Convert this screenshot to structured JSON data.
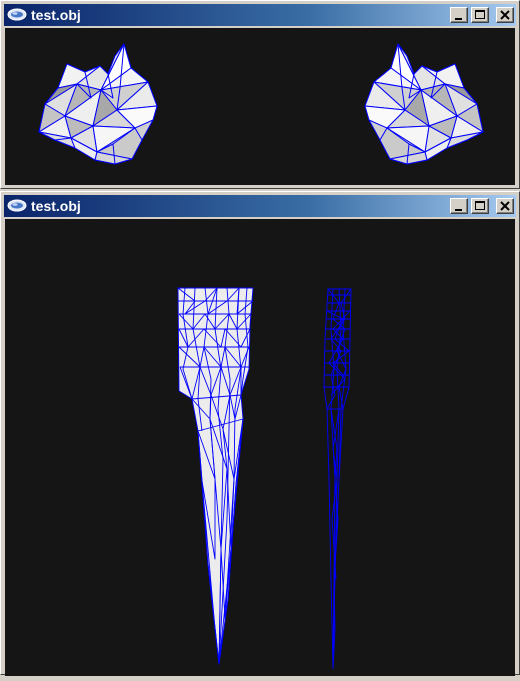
{
  "windows": [
    {
      "title": "test.obj",
      "controls": {
        "minimize": "minimize-icon",
        "maximize": "maximize-icon",
        "close": "close-icon"
      },
      "viewport": {
        "background": "#151515",
        "model": "top view of mesh, two copies (shaded and wireframe)"
      }
    },
    {
      "title": "test.obj",
      "controls": {
        "minimize": "minimize-icon",
        "maximize": "maximize-icon",
        "close": "close-icon"
      },
      "viewport": {
        "background": "#151515",
        "model": "side view of spike mesh, shaded and wireframe"
      }
    }
  ],
  "colors": {
    "titlebar_start": "#0a246a",
    "titlebar_end": "#a6caf0",
    "wireframe": "#0000ff",
    "mesh_fill": "#e8e8e8",
    "window_chrome": "#d4d0c8"
  }
}
